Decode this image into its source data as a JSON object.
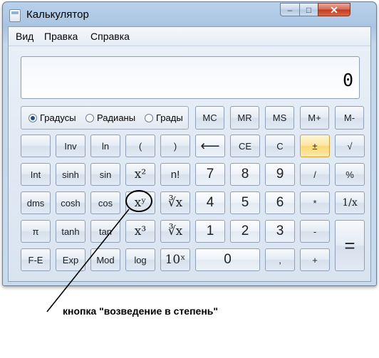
{
  "window": {
    "title": "Калькулятор",
    "controls": {
      "minimize": "–",
      "maximize": "□",
      "close": "✕"
    }
  },
  "menu": [
    "Вид",
    "Правка",
    "Справка"
  ],
  "display": {
    "value": "0"
  },
  "angle_units": {
    "options": [
      "Градусы",
      "Радианы",
      "Грады"
    ],
    "selected": "Градусы"
  },
  "buttons": {
    "mc": "MC",
    "mr": "MR",
    "ms": "MS",
    "mplus": "M+",
    "mminus": "M-",
    "inv": "Inv",
    "ln": "ln",
    "lparen": "(",
    "rparen": ")",
    "backspace": "⟵",
    "ce": "CE",
    "c": "C",
    "plusminus": "±",
    "sqrt": "√",
    "int": "Int",
    "sinh": "sinh",
    "sin": "sin",
    "x2": "x²",
    "fact": "n!",
    "n7": "7",
    "n8": "8",
    "n9": "9",
    "div": "/",
    "percent": "%",
    "dms": "dms",
    "cosh": "cosh",
    "cos": "cos",
    "xy": "xʸ",
    "yroot": "∛x",
    "n4": "4",
    "n5": "5",
    "n6": "6",
    "mul": "*",
    "recip": "1/x",
    "pi": "π",
    "tanh": "tanh",
    "tan": "tan",
    "x3": "x³",
    "cuberoot": "∛x",
    "n1": "1",
    "n2": "2",
    "n3": "3",
    "sub": "-",
    "equals": "=",
    "fe": "F-E",
    "exp": "Exp",
    "mod": "Mod",
    "log": "log",
    "pow10": "10ˣ",
    "n0": "0",
    "dot": ",",
    "add": "+"
  },
  "annotation": {
    "caption": "кнопка \"возведение в степень\""
  }
}
